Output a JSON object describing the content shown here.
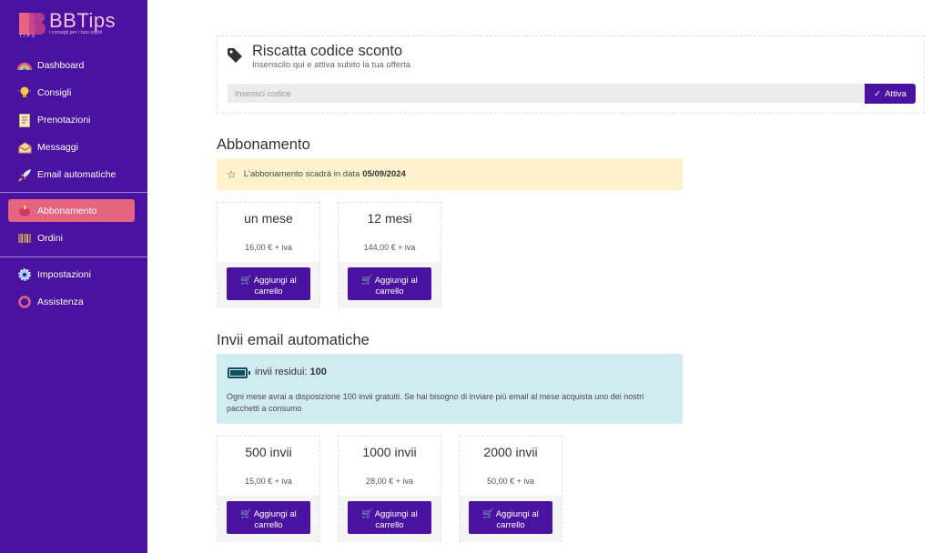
{
  "brand": {
    "name": "BBTips",
    "tagline": "i consigli per i tuoi ospiti",
    "mark_sub": "TIPS"
  },
  "sidebar": {
    "group1": [
      {
        "label": "Dashboard",
        "icon": "rainbow-icon"
      },
      {
        "label": "Consigli",
        "icon": "lightbulb-icon"
      },
      {
        "label": "Prenotazioni",
        "icon": "document-icon"
      },
      {
        "label": "Messaggi",
        "icon": "envelope-icon"
      },
      {
        "label": "Email automatiche",
        "icon": "rocket-icon"
      }
    ],
    "group2": [
      {
        "label": "Abbonamento",
        "icon": "piggy-icon",
        "active": true
      },
      {
        "label": "Ordini",
        "icon": "barcode-icon"
      }
    ],
    "group3": [
      {
        "label": "Impostazioni",
        "icon": "gear-icon"
      },
      {
        "label": "Assistenza",
        "icon": "lifebuoy-icon"
      }
    ]
  },
  "coupon": {
    "title": "Riscatta codice sconto",
    "subtitle": "Inseriscilo qui e attiva subito la tua offerta",
    "placeholder": "Inserisci codice",
    "button": "Attiva"
  },
  "subscription": {
    "title": "Abbonamento",
    "alert_text": "L'abbonamento scadrà in data",
    "alert_date": "05/09/2024",
    "plans": [
      {
        "name": "un mese",
        "price": "16,00 € + iva",
        "button": "Aggiungi al carrello"
      },
      {
        "name": "12 mesi",
        "price": "144,00 € + iva",
        "button": "Aggiungi al carrello"
      }
    ]
  },
  "emails": {
    "title": "Invii email automatiche",
    "remaining_label": "invii residui:",
    "remaining_value": "100",
    "info": "Ogni mese avrai a disposizione 100 invii gratuiti. Se hai bisogno di inviare più email al mese acquista uno dei nostri pacchetti a consumo",
    "packs": [
      {
        "name": "500 invii",
        "price": "15,00 € + iva",
        "button": "Aggiungi al carrello"
      },
      {
        "name": "1000 invii",
        "price": "28,00 € + iva",
        "button": "Aggiungi al carrello"
      },
      {
        "name": "2000 invii",
        "price": "50,00 € + iva",
        "button": "Aggiungi al carrello"
      }
    ]
  },
  "colors": {
    "sidebar": "#4a12a0",
    "active": "#e5647f",
    "primary": "#4a12a0",
    "warning_bg": "#fdf2cb",
    "info_bg": "#d1ecf1"
  }
}
